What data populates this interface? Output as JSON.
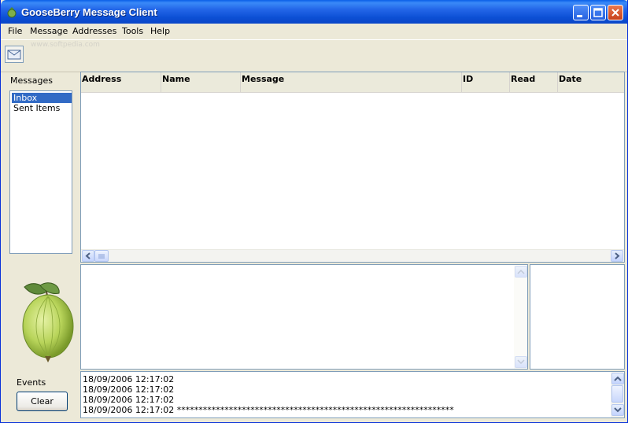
{
  "window": {
    "title": "GooseBerry Message Client"
  },
  "menu": {
    "items": [
      "File",
      "Message",
      "Addresses",
      "Tools",
      "Help"
    ]
  },
  "toolbar": {
    "watermark": "www.softpedia.com"
  },
  "folders": {
    "label": "Messages",
    "items": [
      "Inbox",
      "Sent Items"
    ],
    "selected": "Inbox"
  },
  "message_list": {
    "columns": [
      "Address",
      "Name",
      "Message",
      "ID",
      "Read",
      "Date"
    ],
    "rows": []
  },
  "events": {
    "label": "Events",
    "clear_label": "Clear",
    "lines": [
      "18/09/2006 12:17:02",
      "18/09/2006 12:17:02",
      "18/09/2006 12:17:02",
      "18/09/2006 12:17:02 ****************************************************************"
    ]
  },
  "colors": {
    "title_bar": "#0a46c8",
    "selection": "#316ac5",
    "border": "#7f9db9"
  }
}
